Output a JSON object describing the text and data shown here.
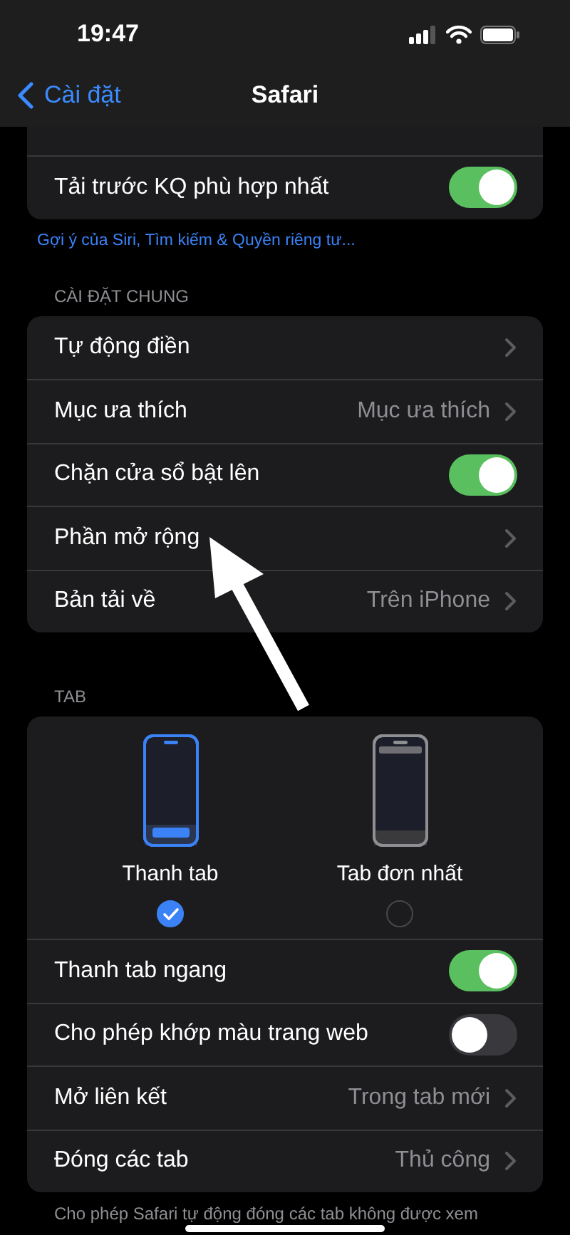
{
  "status_bar": {
    "time": "19:47"
  },
  "nav": {
    "back": "Cài đặt",
    "title": "Safari"
  },
  "top_group": {
    "rows": [
      {
        "kind": "toggle",
        "label": "Tải trước KQ phù hợp nhất",
        "on": true
      }
    ],
    "footer_link": "Gợi ý của Siri, Tìm kiếm & Quyền riêng tư..."
  },
  "general": {
    "header": "CÀI ĐẶT CHUNG",
    "rows": [
      {
        "kind": "chevron",
        "label": "Tự động điền"
      },
      {
        "kind": "chevron",
        "label": "Mục ưa thích",
        "value": "Mục ưa thích"
      },
      {
        "kind": "toggle",
        "label": "Chặn cửa sổ bật lên",
        "on": true
      },
      {
        "kind": "chevron",
        "label": "Phần mở rộng"
      },
      {
        "kind": "chevron",
        "label": "Bản tải về",
        "value": "Trên iPhone"
      }
    ]
  },
  "tabs": {
    "header": "TAB",
    "layouts": [
      {
        "kind": "tab-bar",
        "label": "Thanh tab",
        "selected": true
      },
      {
        "kind": "single",
        "label": "Tab đơn nhất",
        "selected": false
      }
    ],
    "rows": [
      {
        "kind": "toggle",
        "label": "Thanh tab ngang",
        "on": true
      },
      {
        "kind": "toggle",
        "label": "Cho phép khớp màu trang web",
        "on": false
      },
      {
        "kind": "chevron",
        "label": "Mở liên kết",
        "value": "Trong tab mới"
      },
      {
        "kind": "chevron",
        "label": "Đóng các tab",
        "value": "Thủ công"
      }
    ],
    "footer": "Cho phép Safari tự động đóng các tab không được xem"
  }
}
